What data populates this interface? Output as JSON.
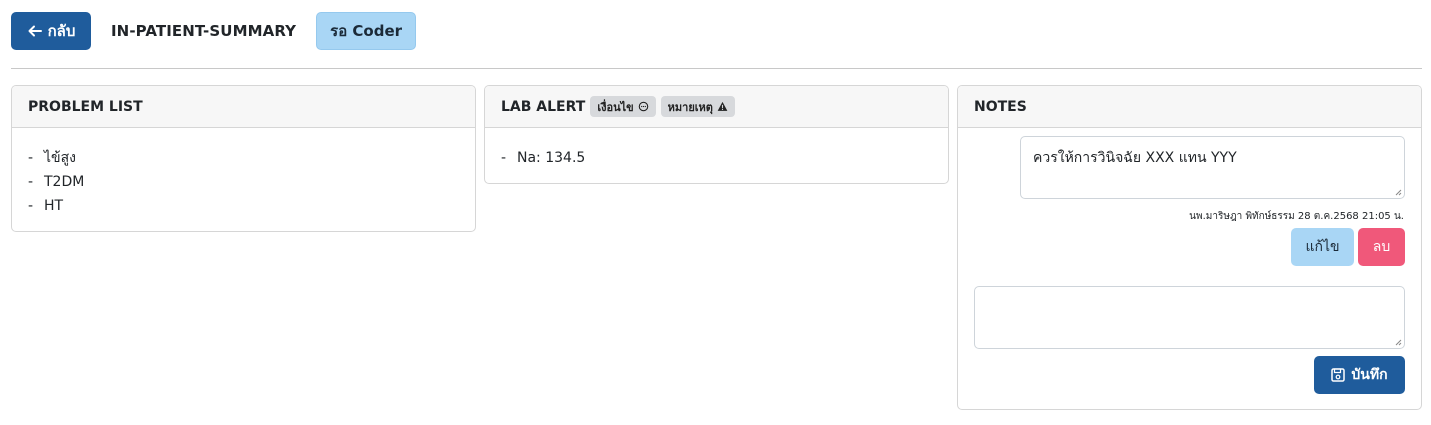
{
  "header": {
    "back_label": "กลับ",
    "page_title": "IN-PATIENT-SUMMARY",
    "status": "รอ Coder"
  },
  "problem_list": {
    "title": "PROBLEM LIST",
    "items": [
      "ไข้สูง",
      "T2DM",
      "HT"
    ]
  },
  "lab_alert": {
    "title": "LAB ALERT",
    "tags": [
      {
        "label": "เงื่อนไข",
        "icon": "comment-icon"
      },
      {
        "label": "หมายเหตุ",
        "icon": "warning-icon"
      }
    ],
    "items": [
      "Na: 134.5"
    ]
  },
  "notes": {
    "title": "NOTES",
    "entries": [
      {
        "text": "ควรให้การวินิจฉัย XXX แทน YYY",
        "meta": "นพ.มาริษฎา พิทักษ์ธรรม 28 ต.ค.2568 21:05 น."
      }
    ],
    "edit_label": "แก้ไข",
    "delete_label": "ลบ",
    "new_note_placeholder": "",
    "save_label": "บันทึก"
  },
  "colors": {
    "primary": "#1f5c9c",
    "info": "#a9d6f5",
    "danger": "#f0587a",
    "tag_bg": "#d7d9dc"
  }
}
